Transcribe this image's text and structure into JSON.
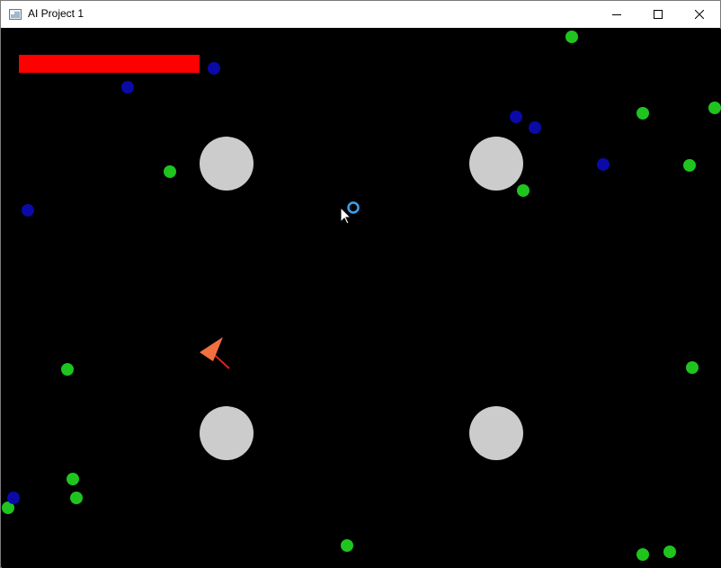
{
  "window": {
    "title": "AI Project 1",
    "controls": {
      "minimize_icon": "minimize-icon",
      "maximize_icon": "maximize-icon",
      "close_icon": "close-icon"
    }
  },
  "game": {
    "background_color": "#000000",
    "health_bar_color": "#ff0000",
    "obstacle_color": "#cccccc",
    "green_agent_color": "#1fc41f",
    "blue_agent_color": "#0a0aa8",
    "player_color": "#f07040",
    "target_color": "#3aa0f0",
    "health": 1.0
  }
}
